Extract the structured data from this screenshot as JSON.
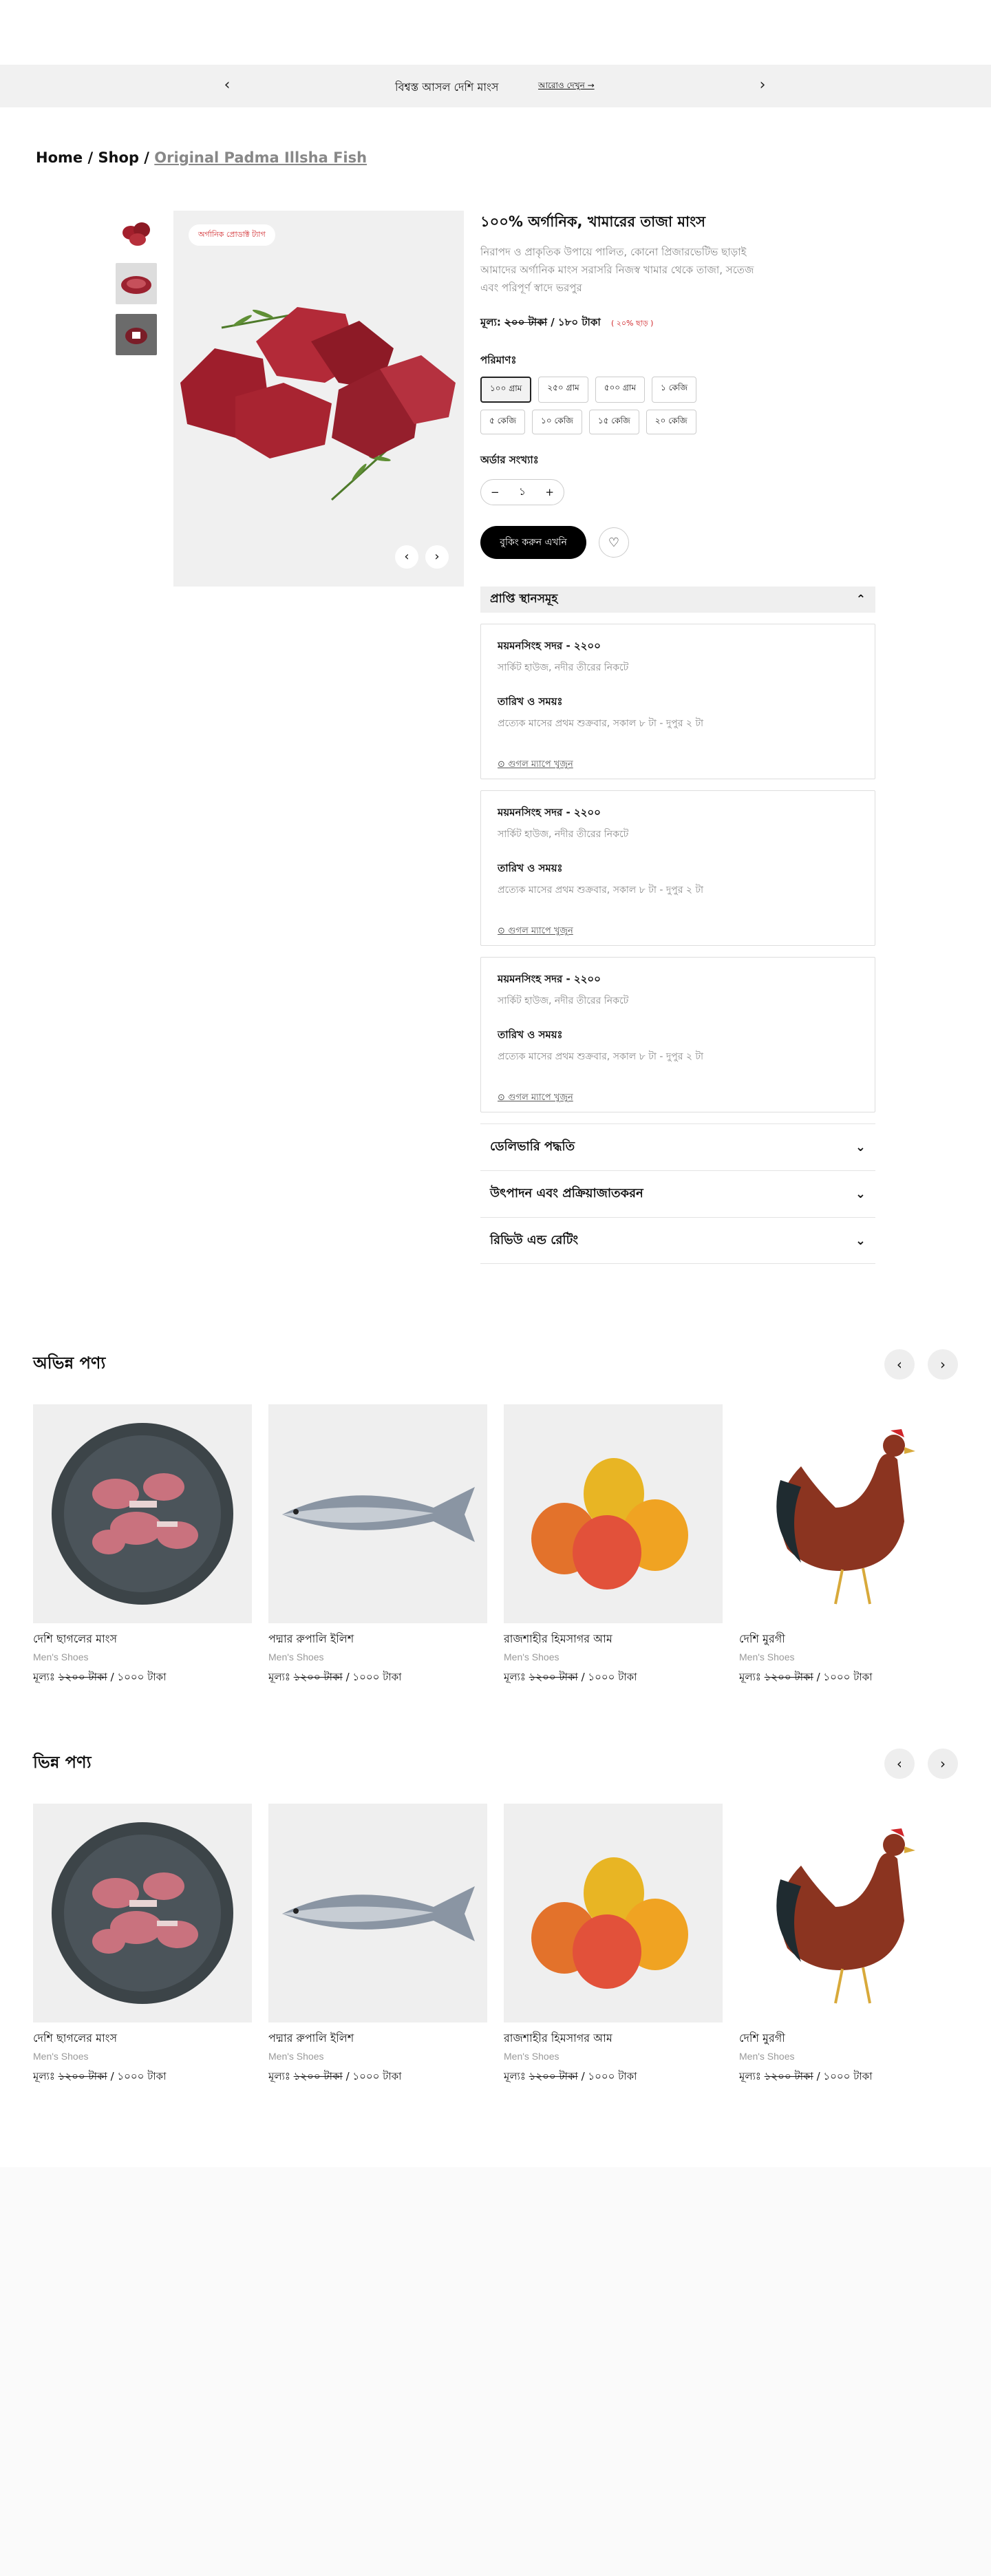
{
  "topbar": {
    "promo": "বিশ্বস্ত আসল দেশি মাংস",
    "more": "আরোও দেখুন →",
    "prev": "‹",
    "next": "›"
  },
  "breadcrumb": {
    "home": "Home",
    "shop": "Shop",
    "current": "Original Padma Illsha Fish",
    "sep": "/"
  },
  "gallery": {
    "badge": "অর্গানিক প্রোডাক্ট ট্যাগ",
    "prev": "‹",
    "next": "›"
  },
  "product": {
    "title": "১০০% অর্গানিক, খামারের তাজা মাংস",
    "description": "নিরাপদ ও প্রাকৃতিক উপায়ে পালিত, কোনো প্রিজারভেটিভ ছাড়াই আমাদের অর্গানিক মাংস সরাসরি নিজস্ব খামার থেকে তাজা, সতেজ এবং পরিপূর্ণ স্বাদে ভরপুর",
    "price_label": "মূল্য:",
    "old_price": "২০০ টাকা",
    "new_price": "/ ১৮০ টাকা",
    "discount": "( ২০% ছাড় )",
    "size_label": "পরিমাণঃ",
    "sizes": [
      "১০০ গ্রাম",
      "২৫০ গ্রাম",
      "৫০০ গ্রাম",
      "১ কেজি",
      "৫ কেজি",
      "১০ কেজি",
      "১৫ কেজি",
      "২০ কেজি"
    ],
    "qty_label": "অর্ডার সংখ্যাঃ",
    "qty": "১",
    "minus": "−",
    "plus": "+",
    "buy": "বুকিং করুন এখনি",
    "fav": "♡"
  },
  "pickup": {
    "title": "প্রাপ্তি স্থানসমূহ",
    "toggle": "⌃",
    "locations": [
      {
        "name": "ময়মনসিংহ সদর - ২২০০",
        "addr": "সার্কিট হাউজ, নদীর তীরের নিকটে",
        "time_label": "তারিখ ও সময়ঃ",
        "time": "প্রত্যেক মাসের প্রথম শুক্রবার, সকাল ৮ টা - দুপুর ২ টা",
        "map": "গুগল ম্যাপে খুজুন"
      },
      {
        "name": "ময়মনসিংহ সদর - ২২০০",
        "addr": "সার্কিট হাউজ, নদীর তীরের নিকটে",
        "time_label": "তারিখ ও সময়ঃ",
        "time": "প্রত্যেক মাসের প্রথম শুক্রবার, সকাল ৮ টা - দুপুর ২ টা",
        "map": "গুগল ম্যাপে খুজুন"
      },
      {
        "name": "ময়মনসিংহ সদর - ২২০০",
        "addr": "সার্কিট হাউজ, নদীর তীরের নিকটে",
        "time_label": "তারিখ ও সময়ঃ",
        "time": "প্রত্যেক মাসের প্রথম শুক্রবার, সকাল ৮ টা - দুপুর ২ টা",
        "map": "গুগল ম্যাপে খুজুন"
      }
    ]
  },
  "accordions": [
    "ডেলিভারি পদ্ধতি",
    "উৎপাদন এবং প্রক্রিয়াজাতকরন",
    "রিভিউ এন্ড রেটিং"
  ],
  "chev": "⌄",
  "sections": [
    {
      "title": "অভিন্ন পণ্য",
      "prev": "‹",
      "next": "›"
    },
    {
      "title": "ভিন্ন পণ্য",
      "prev": "‹",
      "next": "›"
    }
  ],
  "cards": [
    {
      "name": "দেশি ছাগলের মাংস",
      "cat": "Men's Shoes",
      "price_label": "মূল্যঃ",
      "old": "১২০০ টাকা",
      "new": "/ ১০০০ টাকা"
    },
    {
      "name": "পদ্মার রুপালি ইলিশ",
      "cat": "Men's Shoes",
      "price_label": "মূল্যঃ",
      "old": "১২০০ টাকা",
      "new": "/ ১০০০ টাকা"
    },
    {
      "name": "রাজশাহীর হিমসাগর আম",
      "cat": "Men's Shoes",
      "price_label": "মূল্যঃ",
      "old": "১২০০ টাকা",
      "new": "/ ১০০০ টাকা"
    },
    {
      "name": "দেশি মুরগী",
      "cat": "Men's Shoes",
      "price_label": "মূল্যঃ",
      "old": "১২০০ টাকা",
      "new": "/ ১০০০ টাকা"
    }
  ],
  "colors": {
    "accent": "#d0262a",
    "button": "#000000"
  }
}
